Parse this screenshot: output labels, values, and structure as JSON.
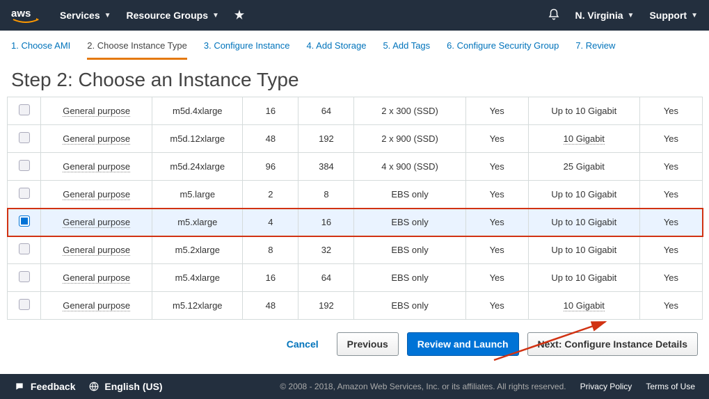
{
  "topbar": {
    "services": "Services",
    "resourceGroups": "Resource Groups",
    "region": "N. Virginia",
    "support": "Support"
  },
  "wizard": {
    "s1": "1. Choose AMI",
    "s2": "2. Choose Instance Type",
    "s3": "3. Configure Instance",
    "s4": "4. Add Storage",
    "s5": "5. Add Tags",
    "s6": "6. Configure Security Group",
    "s7": "7. Review"
  },
  "stepTitle": "Step 2: Choose an Instance Type",
  "rows": [
    {
      "family": "General purpose",
      "type": "m5d.4xlarge",
      "vcpu": "16",
      "mem": "64",
      "storage": "2 x 300 (SSD)",
      "ebs": "Yes",
      "net": "Up to 10 Gigabit",
      "netDotted": false,
      "ipv6": "Yes",
      "selected": false
    },
    {
      "family": "General purpose",
      "type": "m5d.12xlarge",
      "vcpu": "48",
      "mem": "192",
      "storage": "2 x 900 (SSD)",
      "ebs": "Yes",
      "net": "10 Gigabit",
      "netDotted": true,
      "ipv6": "Yes",
      "selected": false
    },
    {
      "family": "General purpose",
      "type": "m5d.24xlarge",
      "vcpu": "96",
      "mem": "384",
      "storage": "4 x 900 (SSD)",
      "ebs": "Yes",
      "net": "25 Gigabit",
      "netDotted": false,
      "ipv6": "Yes",
      "selected": false
    },
    {
      "family": "General purpose",
      "type": "m5.large",
      "vcpu": "2",
      "mem": "8",
      "storage": "EBS only",
      "ebs": "Yes",
      "net": "Up to 10 Gigabit",
      "netDotted": false,
      "ipv6": "Yes",
      "selected": false
    },
    {
      "family": "General purpose",
      "type": "m5.xlarge",
      "vcpu": "4",
      "mem": "16",
      "storage": "EBS only",
      "ebs": "Yes",
      "net": "Up to 10 Gigabit",
      "netDotted": false,
      "ipv6": "Yes",
      "selected": true
    },
    {
      "family": "General purpose",
      "type": "m5.2xlarge",
      "vcpu": "8",
      "mem": "32",
      "storage": "EBS only",
      "ebs": "Yes",
      "net": "Up to 10 Gigabit",
      "netDotted": false,
      "ipv6": "Yes",
      "selected": false
    },
    {
      "family": "General purpose",
      "type": "m5.4xlarge",
      "vcpu": "16",
      "mem": "64",
      "storage": "EBS only",
      "ebs": "Yes",
      "net": "Up to 10 Gigabit",
      "netDotted": false,
      "ipv6": "Yes",
      "selected": false
    },
    {
      "family": "General purpose",
      "type": "m5.12xlarge",
      "vcpu": "48",
      "mem": "192",
      "storage": "EBS only",
      "ebs": "Yes",
      "net": "10 Gigabit",
      "netDotted": true,
      "ipv6": "Yes",
      "selected": false
    }
  ],
  "actions": {
    "cancel": "Cancel",
    "previous": "Previous",
    "reviewLaunch": "Review and Launch",
    "next": "Next: Configure Instance Details"
  },
  "bottombar": {
    "feedback": "Feedback",
    "language": "English (US)",
    "copyright": "© 2008 - 2018, Amazon Web Services, Inc. or its affiliates. All rights reserved.",
    "privacy": "Privacy Policy",
    "terms": "Terms of Use"
  }
}
